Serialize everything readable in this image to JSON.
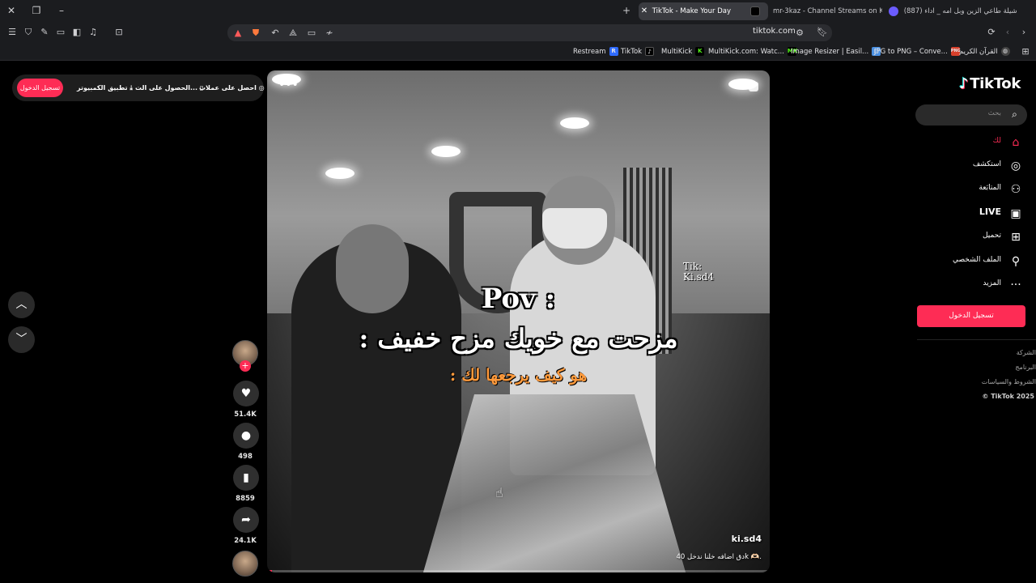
{
  "browser": {
    "tabs": [
      {
        "title": "TikTok - Make Your Day"
      },
      {
        "title": "mr-3kaz - Channel Streams on Kick"
      },
      {
        "title": "(887) شيلة طاعي الزين وبل امه _ اداء"
      }
    ],
    "url": "tiktok.com",
    "bookmarks": [
      {
        "label": "Restream",
        "badge": "R"
      },
      {
        "label": "TikTok",
        "badge": "♪"
      },
      {
        "label": "MultiKick",
        "badge": "K"
      },
      {
        "label": "MultiKick.com: Watc...",
        "badge": "MK"
      },
      {
        "label": "Image Resizer | Easil...",
        "badge": "▢"
      },
      {
        "label": "JPG to PNG – Conve...",
        "badge": "PNG"
      },
      {
        "label": "القرآن الكريم",
        "badge": "◍"
      }
    ]
  },
  "topbar": {
    "login": "تسجيل الدخول",
    "desktop_app": "تطبيق الكمبيوتر",
    "get_app": "الحصول على الت...",
    "get_coins": "احصل على عملات"
  },
  "video": {
    "pov": "Pov :",
    "line1": "مزحت مع خويك مزح خفيف :",
    "line2": "هو كيف يرجعها لك :",
    "watermark1": "Tik:",
    "watermark2": "Ki.sd4",
    "username": "ki.sd4",
    "caption": "دق اضافه خلنا ندخل 40k 🫶🏻.",
    "progress": 0.01
  },
  "actions": {
    "likes": "51.4K",
    "comments": "498",
    "saves": "8859",
    "shares": "24.1K"
  },
  "sidebar": {
    "logo": "TikTok",
    "search_placeholder": "بحث",
    "items": [
      {
        "label": "لك",
        "icon": "home-icon",
        "active": true
      },
      {
        "label": "استكشف",
        "icon": "compass-icon"
      },
      {
        "label": "المتابَعة",
        "icon": "user-plus-icon"
      },
      {
        "label": "LIVE",
        "icon": "live-tv-icon"
      },
      {
        "label": "تحميل",
        "icon": "upload-plus-icon"
      },
      {
        "label": "الملف الشخصي",
        "icon": "profile-icon"
      },
      {
        "label": "المزيد",
        "icon": "more-dots-icon"
      }
    ],
    "login": "تسجيل الدخول",
    "footer": [
      "الشركة",
      "البرنامج",
      "الشروط والسياسات",
      "© TikTok 2025"
    ]
  },
  "colors": {
    "accent": "#fe2c55",
    "background": "#000000",
    "chrome": "#1b1c1f"
  }
}
